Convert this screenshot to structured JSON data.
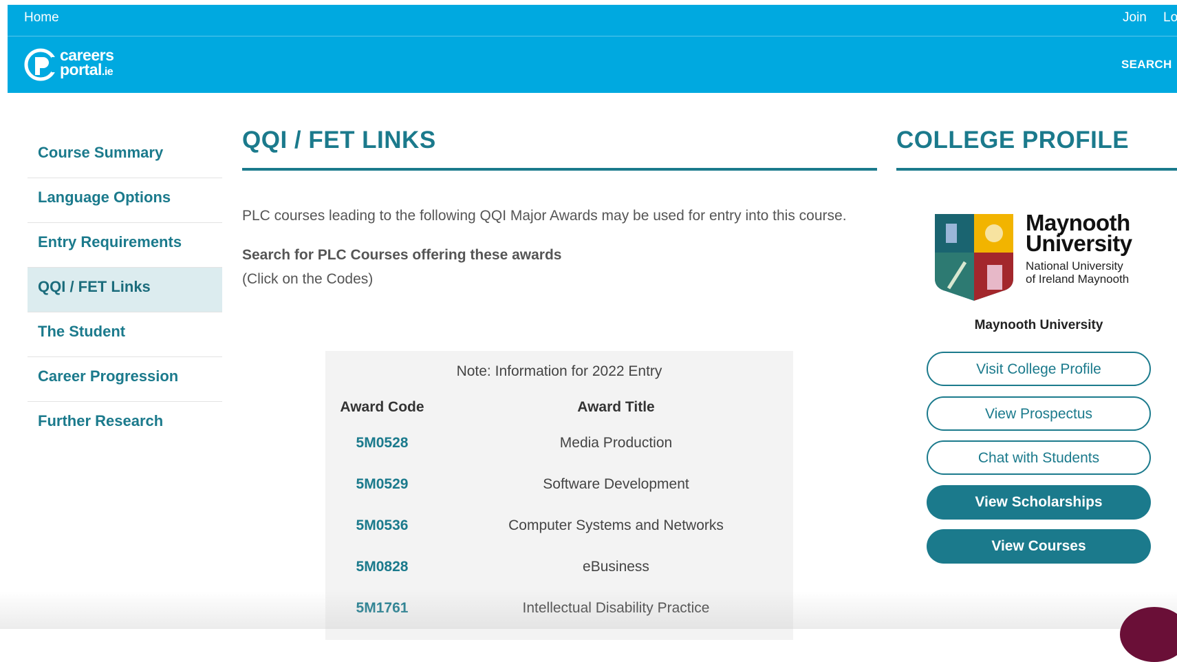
{
  "topbar": {
    "home_label": "Home",
    "join_label": "Join",
    "login_label": "Lo",
    "search_label": "SEARCH",
    "logo_word1": "careers",
    "logo_word2": "portal",
    "logo_tld": ".ie",
    "bg_color": "#00a9e0"
  },
  "sidebar": {
    "items": [
      {
        "label": "Course Summary"
      },
      {
        "label": "Language Options"
      },
      {
        "label": "Entry Requirements"
      },
      {
        "label": "QQI / FET Links",
        "active": true
      },
      {
        "label": "The Student"
      },
      {
        "label": "Career Progression"
      },
      {
        "label": "Further Research"
      }
    ]
  },
  "main": {
    "title": "QQI / FET LINKS",
    "intro": "PLC courses leading to the following QQI Major Awards may be used for entry into this course.",
    "subhead": "Search for PLC Courses offering these awards",
    "hint": "(Click on the Codes)"
  },
  "awards": {
    "note": "Note: Information for 2022 Entry",
    "headers": {
      "code": "Award Code",
      "title": "Award Title"
    },
    "rows": [
      {
        "code": "5M0528",
        "title": "Media Production"
      },
      {
        "code": "5M0529",
        "title": "Software Development"
      },
      {
        "code": "5M0536",
        "title": "Computer Systems and Networks"
      },
      {
        "code": "5M0828",
        "title": "eBusiness"
      },
      {
        "code": "5M1761",
        "title": "Intellectual Disability Practice"
      }
    ]
  },
  "profile": {
    "title": "COLLEGE PROFILE",
    "logo_line1": "Maynooth",
    "logo_line2": "University",
    "logo_sub1": "National University",
    "logo_sub2": "of Ireland Maynooth",
    "college_name": "Maynooth University",
    "buttons": {
      "visit": "Visit College Profile",
      "prospectus": "View Prospectus",
      "chat": "Chat with Students",
      "scholarships": "View Scholarships",
      "courses": "View Courses"
    },
    "accent_color": "#1b7a8c"
  }
}
